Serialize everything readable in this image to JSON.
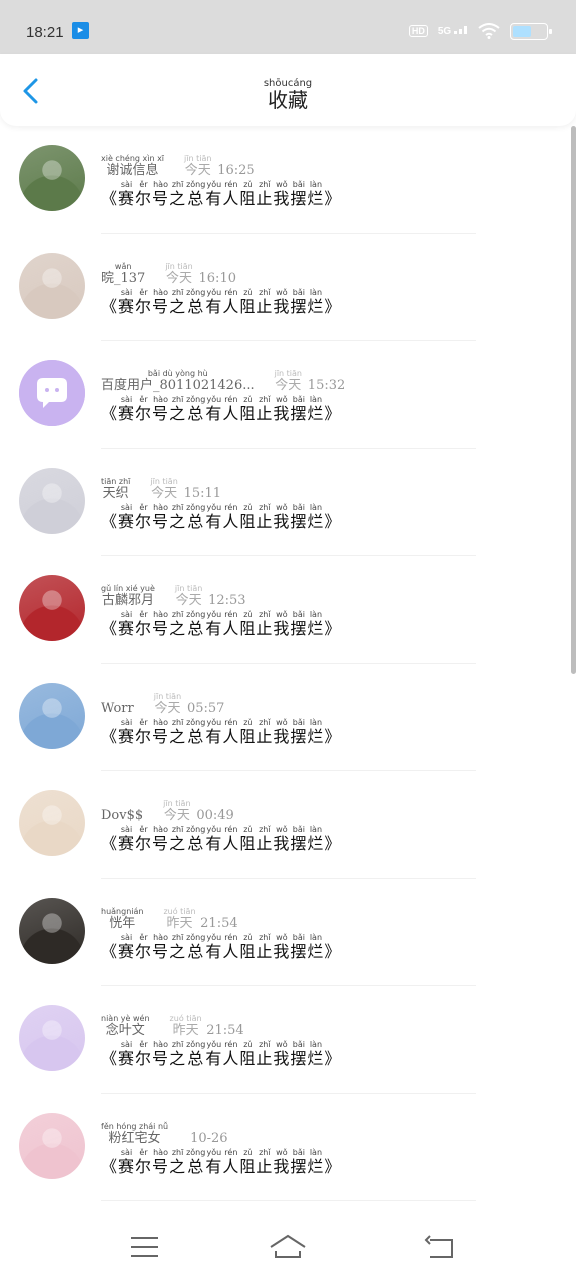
{
  "status": {
    "time": "18:21",
    "hd": "HD",
    "network": "5G",
    "battery_level": 0.6
  },
  "header": {
    "title": "收藏",
    "title_pinyin": "shōucáng"
  },
  "time_word": {
    "today": "今天",
    "today_pinyin": "jīn tiān",
    "yesterday": "昨天",
    "yesterday_pinyin": "zuó tiān"
  },
  "message": {
    "open": "《",
    "close": "》",
    "chars": [
      "赛",
      "尔",
      "号",
      "之",
      "总",
      "有",
      "人",
      "阻",
      "止",
      "我",
      "摆",
      "烂"
    ],
    "pinyin": [
      "sài",
      "ěr",
      "hào",
      "zhī",
      "zǒng",
      "yǒu",
      "rén",
      "zǔ",
      "zhǐ",
      "wǒ",
      "bǎi",
      "làn"
    ]
  },
  "items": [
    {
      "name": "谢诚信息",
      "name_pinyin": "xiè chéng xìn xī",
      "day": "今天",
      "day_pinyin": "jīn tiān",
      "time": "16:25",
      "avatar_color": "#5c7a4a"
    },
    {
      "name": "晥_137",
      "name_pinyin": "wǎn",
      "day": "今天",
      "day_pinyin": "jīn tiān",
      "time": "16:10",
      "avatar_color": "#d8c9bf"
    },
    {
      "name": "百度用户_8011021426...",
      "name_pinyin": "bǎi dù yòng hù",
      "day": "今天",
      "day_pinyin": "jīn tiān",
      "time": "15:32",
      "avatar_color": "#c9b3f0"
    },
    {
      "name": "天织",
      "name_pinyin": "tiān zhī",
      "day": "今天",
      "day_pinyin": "jīn tiān",
      "time": "15:11",
      "avatar_color": "#cfcfd8"
    },
    {
      "name": "古麟邪月",
      "name_pinyin": "gǔ lín xié yuè",
      "day": "今天",
      "day_pinyin": "jīn tiān",
      "time": "12:53",
      "avatar_color": "#b3262c"
    },
    {
      "name": "Worr",
      "name_pinyin": "",
      "day": "今天",
      "day_pinyin": "jīn tiān",
      "time": "05:57",
      "avatar_color": "#7ea8d6"
    },
    {
      "name": "Dov$$",
      "name_pinyin": "",
      "day": "今天",
      "day_pinyin": "jīn tiān",
      "time": "00:49",
      "avatar_color": "#e9d8c6"
    },
    {
      "name": "恍年",
      "name_pinyin": "huǎngnián",
      "day": "昨天",
      "day_pinyin": "zuó tiān",
      "time": "21:54",
      "avatar_color": "#2e2a26"
    },
    {
      "name": "念叶文",
      "name_pinyin": "niàn yè wén",
      "day": "昨天",
      "day_pinyin": "zuó tiān",
      "time": "21:54",
      "avatar_color": "#d7c6ef"
    },
    {
      "name": "粉红宅女",
      "name_pinyin": "fěn hóng zhái nǚ",
      "day": "",
      "day_pinyin": "",
      "time": "10-26",
      "avatar_color": "#efc3cf"
    }
  ],
  "colors": {
    "accent": "#1e96e6",
    "status_bg": "#dcdcdc"
  }
}
